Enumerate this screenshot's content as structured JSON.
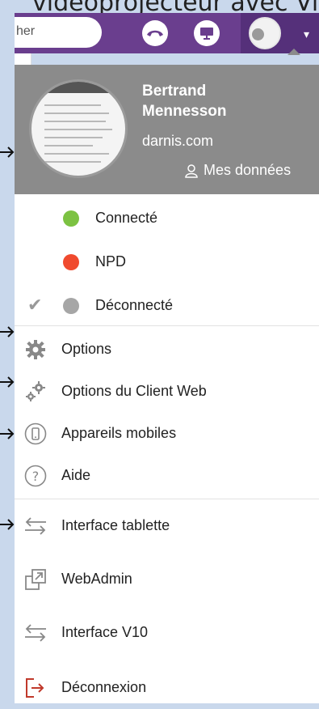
{
  "caption": "vidéoprojecteur avec Vi",
  "search": {
    "placeholder": "her"
  },
  "user": {
    "first_name": "Bertrand",
    "last_name": "Mennesson",
    "domain": "darnis.com",
    "my_data_label": "Mes données"
  },
  "statuses": [
    {
      "label": "Connecté",
      "color": "#7cc242",
      "selected": false
    },
    {
      "label": "NPD",
      "color": "#f04a2e",
      "selected": false
    },
    {
      "label": "Déconnecté",
      "color": "#a6a6a6",
      "selected": true
    }
  ],
  "menu": {
    "options": "Options",
    "web_client_options": "Options du Client Web",
    "mobile_devices": "Appareils mobiles",
    "help": "Aide",
    "tablet_interface": "Interface tablette",
    "webadmin": "WebAdmin",
    "v10_interface": "Interface V10",
    "logout": "Déconnexion"
  },
  "colors": {
    "topbar": "#6a3e8e",
    "header_gray": "#8b8b8b",
    "logout_red": "#c0392b"
  }
}
